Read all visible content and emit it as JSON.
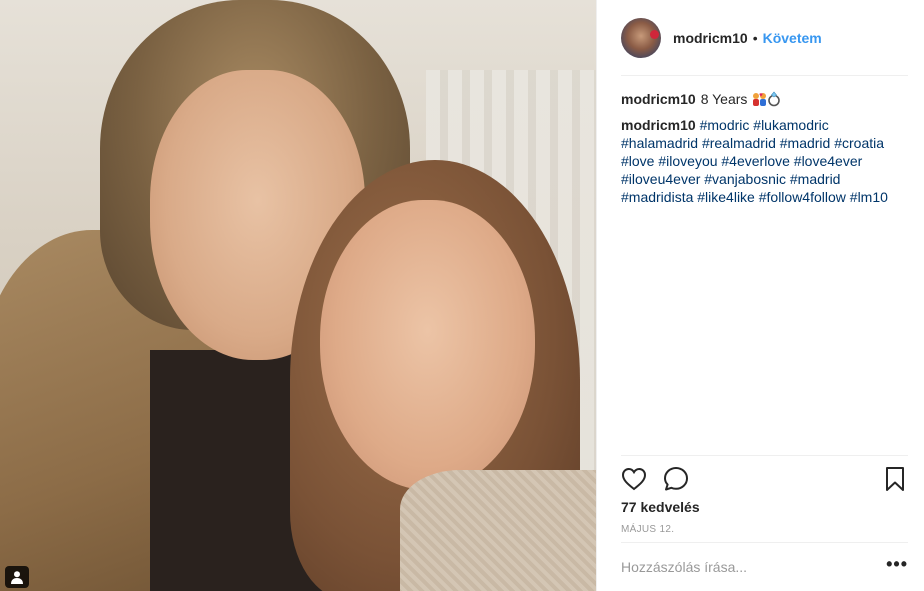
{
  "post": {
    "photo_icon": "person-tag-icon"
  },
  "header": {
    "username": "modricm10",
    "separator": "•",
    "follow_label": "Követem"
  },
  "caption": {
    "author": "modricm10",
    "text": "8 Years",
    "emoji": "couple-with-heart-and-ring-emoji",
    "comment_author": "modricm10",
    "hashtags_line": "#modric #lukamodric #halamadrid #realmadrid #madrid #croatia #love #iloveyou #4everlove #love4ever #iloveu4ever #vanjabosnic #madrid #madridista #like4like #follow4follow #lm10"
  },
  "actions": {
    "like_icon": "heart-icon",
    "comment_icon": "comment-icon",
    "save_icon": "bookmark-icon"
  },
  "likes": "77 kedvelés",
  "date": "MÁJUS 12.",
  "comment": {
    "placeholder": "Hozzászólás írása...",
    "more_label": "•••"
  },
  "colors": {
    "link": "#3897f0",
    "hashtag": "#003569",
    "text": "#262626",
    "muted": "#999999"
  }
}
